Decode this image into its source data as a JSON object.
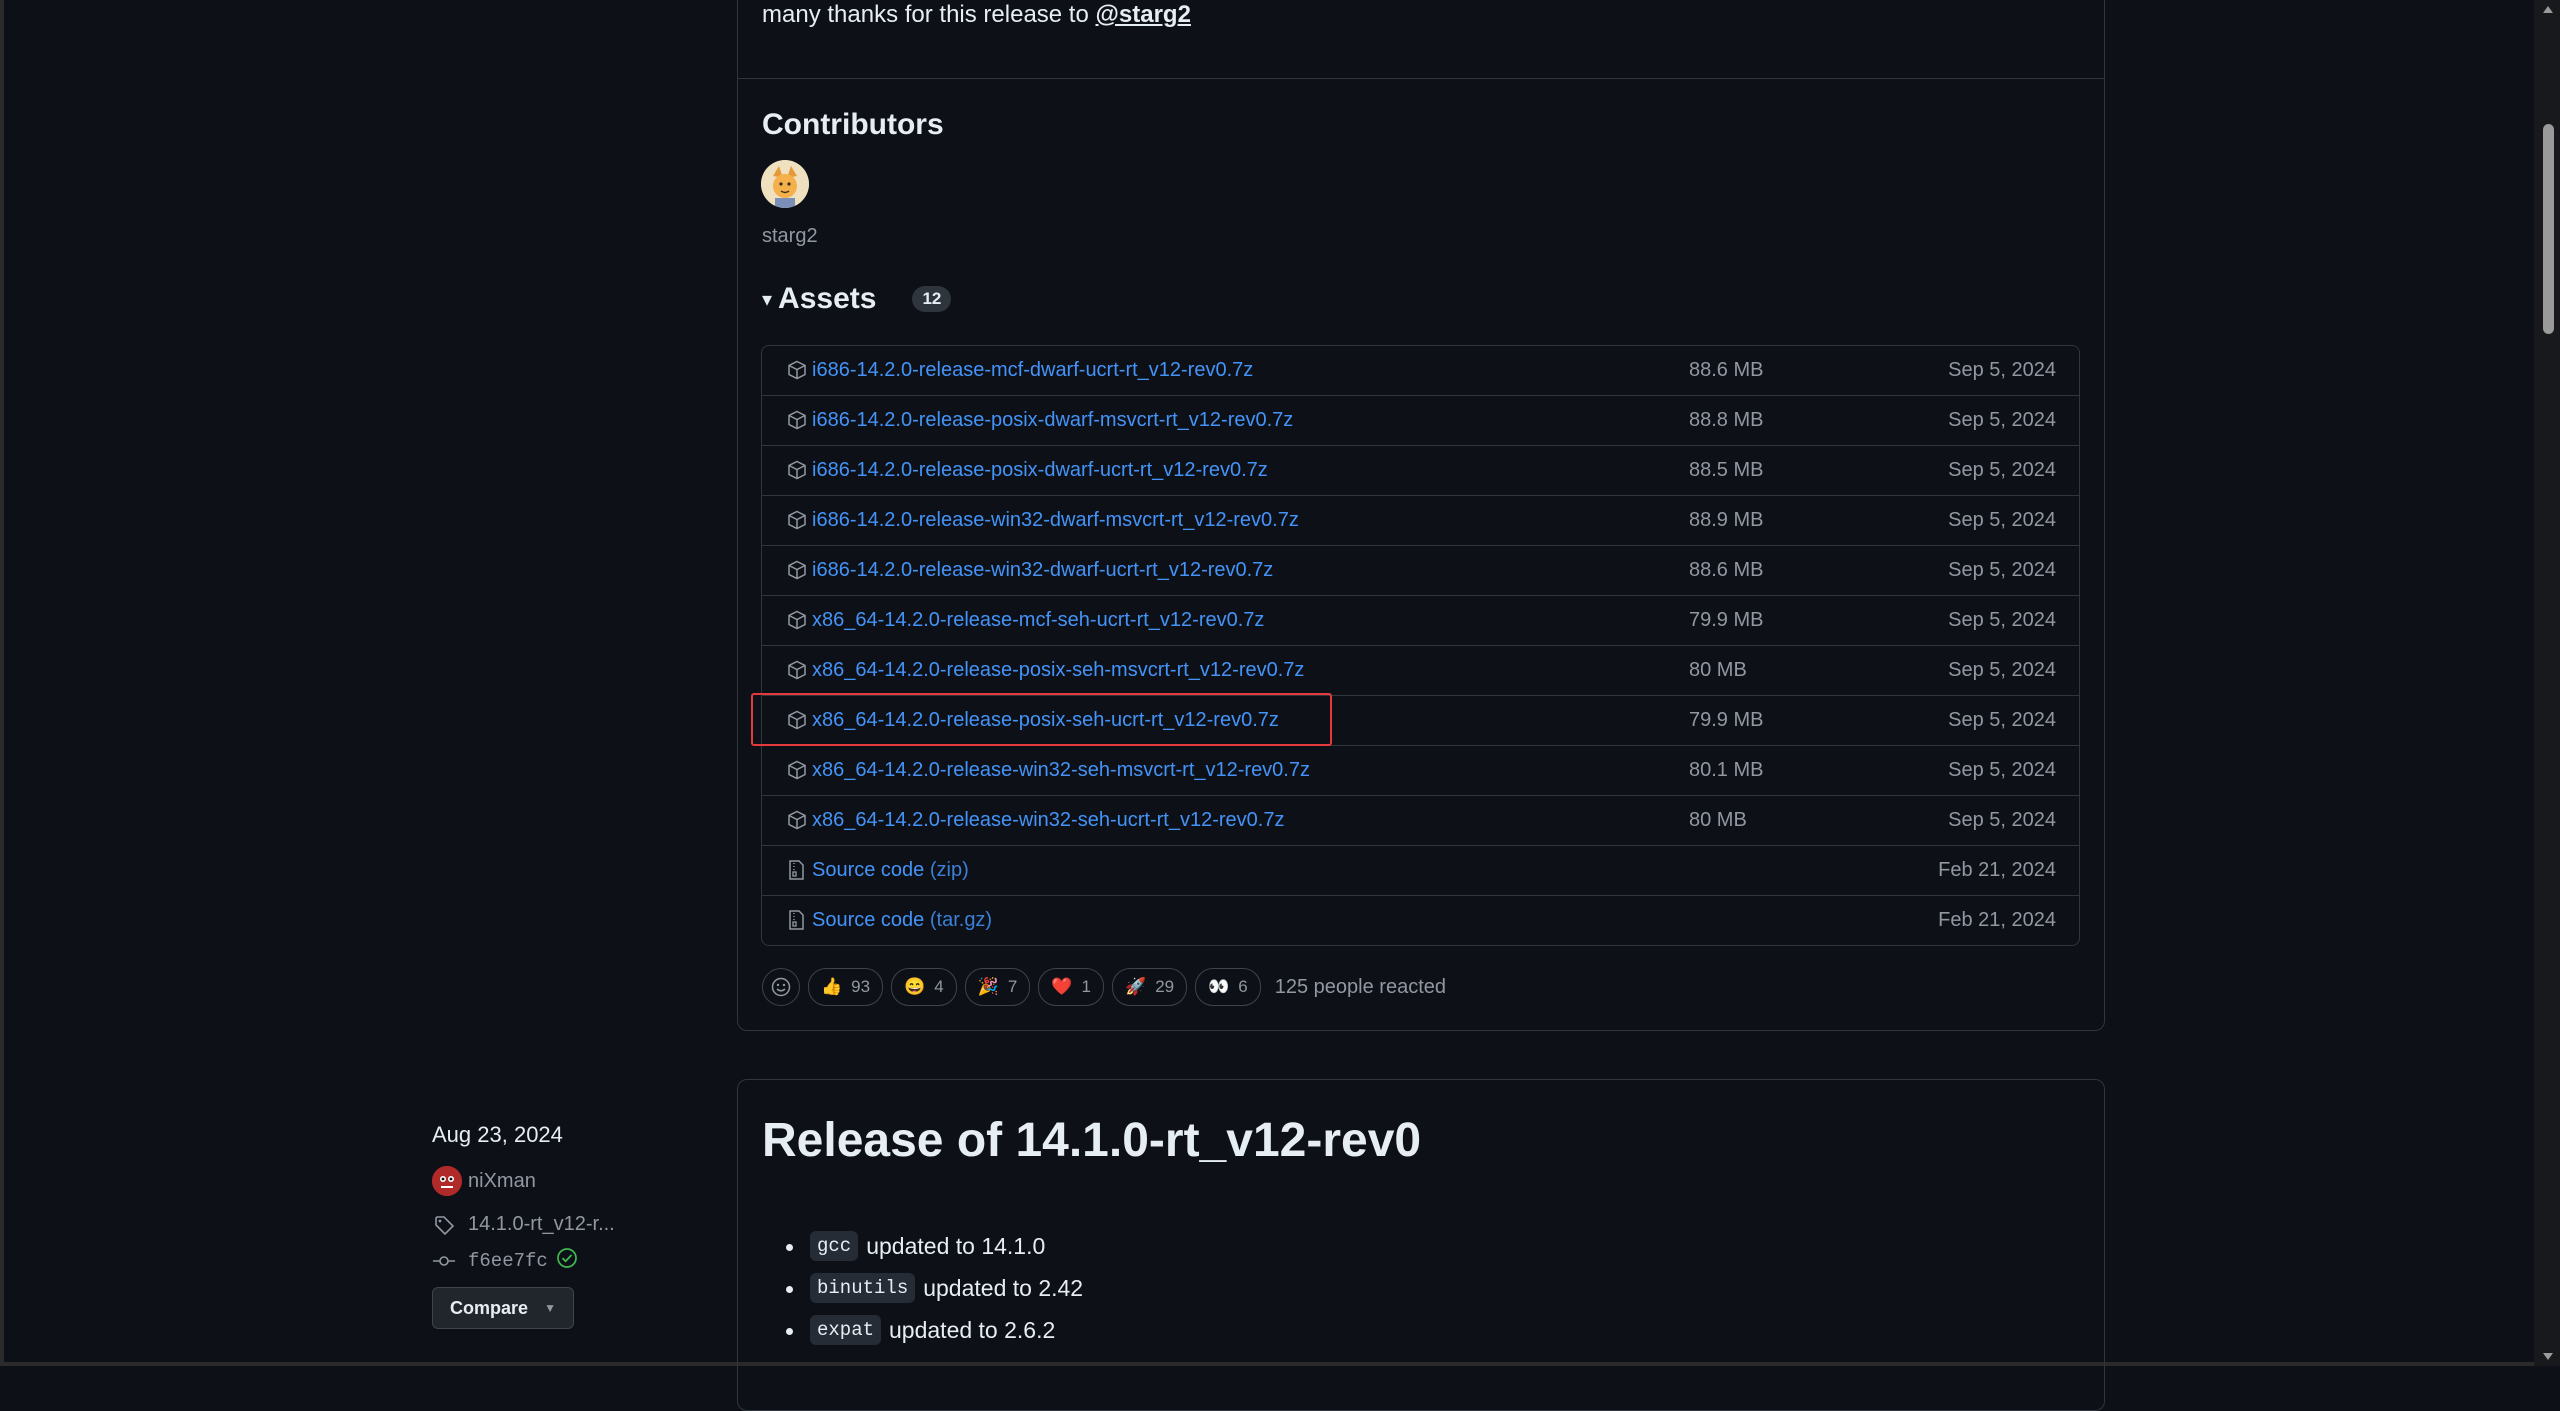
{
  "release_notes": {
    "thanks_text": "many thanks for this release to",
    "thanks_user": "@starg2"
  },
  "contributors": {
    "title": "Contributors",
    "name": "starg2"
  },
  "assets": {
    "title": "Assets",
    "count": "12",
    "items": [
      {
        "name": "i686-14.2.0-release-mcf-dwarf-ucrt-rt_v12-rev0.7z",
        "size": "88.6 MB",
        "date": "Sep 5, 2024"
      },
      {
        "name": "i686-14.2.0-release-posix-dwarf-msvcrt-rt_v12-rev0.7z",
        "size": "88.8 MB",
        "date": "Sep 5, 2024"
      },
      {
        "name": "i686-14.2.0-release-posix-dwarf-ucrt-rt_v12-rev0.7z",
        "size": "88.5 MB",
        "date": "Sep 5, 2024"
      },
      {
        "name": "i686-14.2.0-release-win32-dwarf-msvcrt-rt_v12-rev0.7z",
        "size": "88.9 MB",
        "date": "Sep 5, 2024"
      },
      {
        "name": "i686-14.2.0-release-win32-dwarf-ucrt-rt_v12-rev0.7z",
        "size": "88.6 MB",
        "date": "Sep 5, 2024"
      },
      {
        "name": "x86_64-14.2.0-release-mcf-seh-ucrt-rt_v12-rev0.7z",
        "size": "79.9 MB",
        "date": "Sep 5, 2024"
      },
      {
        "name": "x86_64-14.2.0-release-posix-seh-msvcrt-rt_v12-rev0.7z",
        "size": "80 MB",
        "date": "Sep 5, 2024"
      },
      {
        "name": "x86_64-14.2.0-release-posix-seh-ucrt-rt_v12-rev0.7z",
        "size": "79.9 MB",
        "date": "Sep 5, 2024"
      },
      {
        "name": "x86_64-14.2.0-release-win32-seh-msvcrt-rt_v12-rev0.7z",
        "size": "80.1 MB",
        "date": "Sep 5, 2024"
      },
      {
        "name": "x86_64-14.2.0-release-win32-seh-ucrt-rt_v12-rev0.7z",
        "size": "80 MB",
        "date": "Sep 5, 2024"
      }
    ],
    "source": [
      {
        "name": "Source code",
        "fmt": "(zip)",
        "date": "Feb 21, 2024"
      },
      {
        "name": "Source code",
        "fmt": "(tar.gz)",
        "date": "Feb 21, 2024"
      }
    ]
  },
  "reactions": {
    "items": [
      {
        "emoji": "👍",
        "count": "93"
      },
      {
        "emoji": "😄",
        "count": "4"
      },
      {
        "emoji": "🎉",
        "count": "7"
      },
      {
        "emoji": "❤️",
        "count": "1"
      },
      {
        "emoji": "🚀",
        "count": "29"
      },
      {
        "emoji": "👀",
        "count": "6"
      }
    ],
    "summary": "125 people reacted"
  },
  "next_release": {
    "date": "Aug 23, 2024",
    "author": "niXman",
    "tag": "14.1.0-rt_v12-r...",
    "commit": "f6ee7fc",
    "compare_label": "Compare",
    "title": "Release of 14.1.0-rt_v12-rev0",
    "changes": [
      {
        "code": "gcc",
        "text": "updated to 14.1.0"
      },
      {
        "code": "binutils",
        "text": "updated to 2.42"
      },
      {
        "code": "expat",
        "text": "updated to 2.6.2"
      }
    ]
  },
  "colors": {
    "background": "#0d1117",
    "link": "#4493f8",
    "muted": "#9198a1",
    "border": "#30363d",
    "highlight": "#e5393b"
  }
}
